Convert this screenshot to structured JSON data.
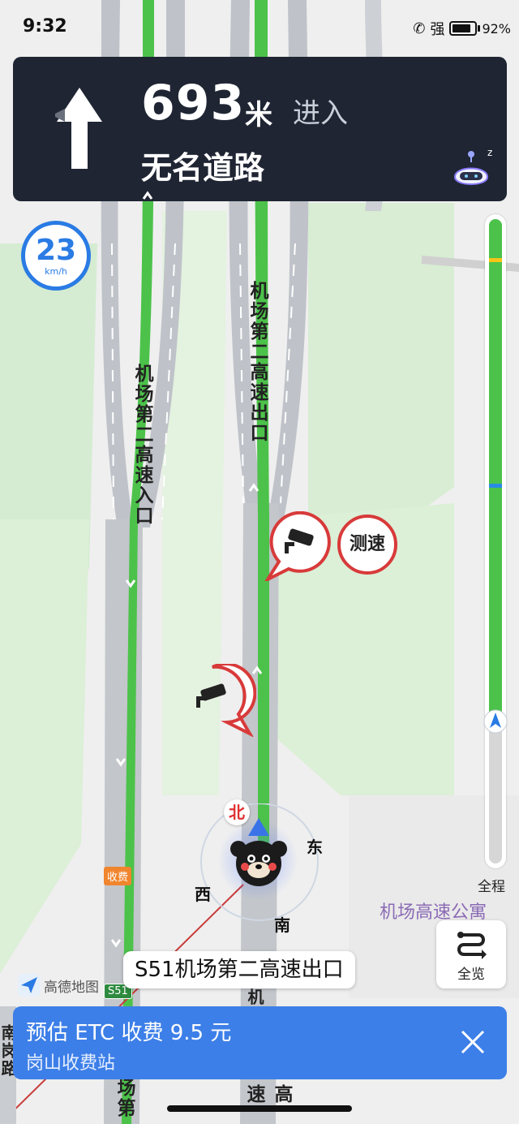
{
  "status_bar": {
    "time": "9:32",
    "signal": "强",
    "battery": "92%"
  },
  "banner": {
    "distance": "693",
    "unit": "米",
    "action": "进入",
    "road": "无名道路"
  },
  "speed": {
    "value": "23",
    "unit": "km/h"
  },
  "map_labels": {
    "road_entry": "机场第二高速入口",
    "road_exit": "机场第二高速出口",
    "poi": "机场高速公寓",
    "bottom_road_a": "场第",
    "bottom_road_b": "高速",
    "bottom_road_c": "机",
    "left_road": "南岗路"
  },
  "speed_check": "测速",
  "compass": {
    "north": "北",
    "east": "东",
    "west": "西",
    "south": "南"
  },
  "progress": {
    "label": "全程",
    "completed_fraction": 0.78
  },
  "overview_button": {
    "label": "全览"
  },
  "current_road": "S51机场第二高速出口",
  "toll_tag": "收费",
  "route_shield": "S51",
  "brand": "高德地图",
  "notice": {
    "line1": "预估 ETC 收费 9.5 元",
    "line2": "岗山收费站"
  },
  "colors": {
    "route": "#4cc24a",
    "banner": "#1f2533",
    "notice": "#3d7fe8",
    "accent": "#2a7be4",
    "alert": "#d83a3a"
  }
}
